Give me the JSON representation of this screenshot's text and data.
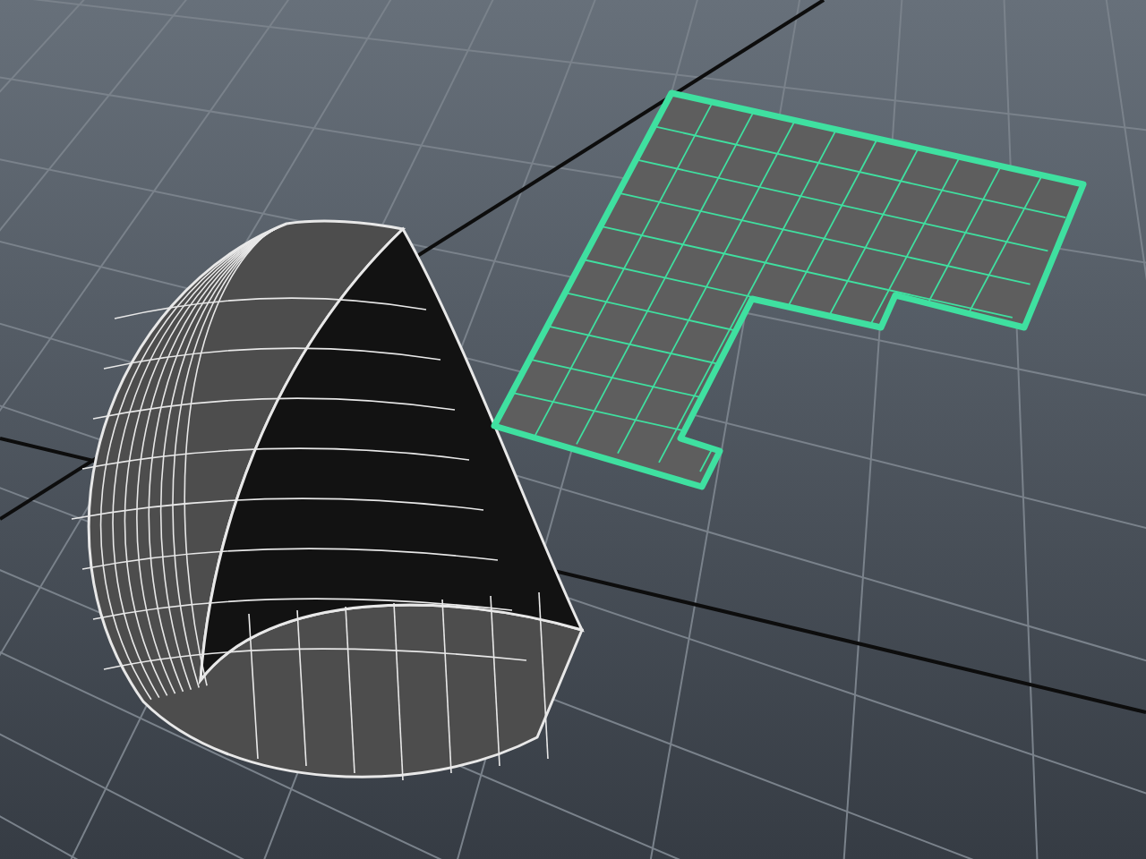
{
  "objects": [
    {
      "kind": "sphere",
      "selected": false
    },
    {
      "kind": "plane",
      "selected": true
    }
  ]
}
